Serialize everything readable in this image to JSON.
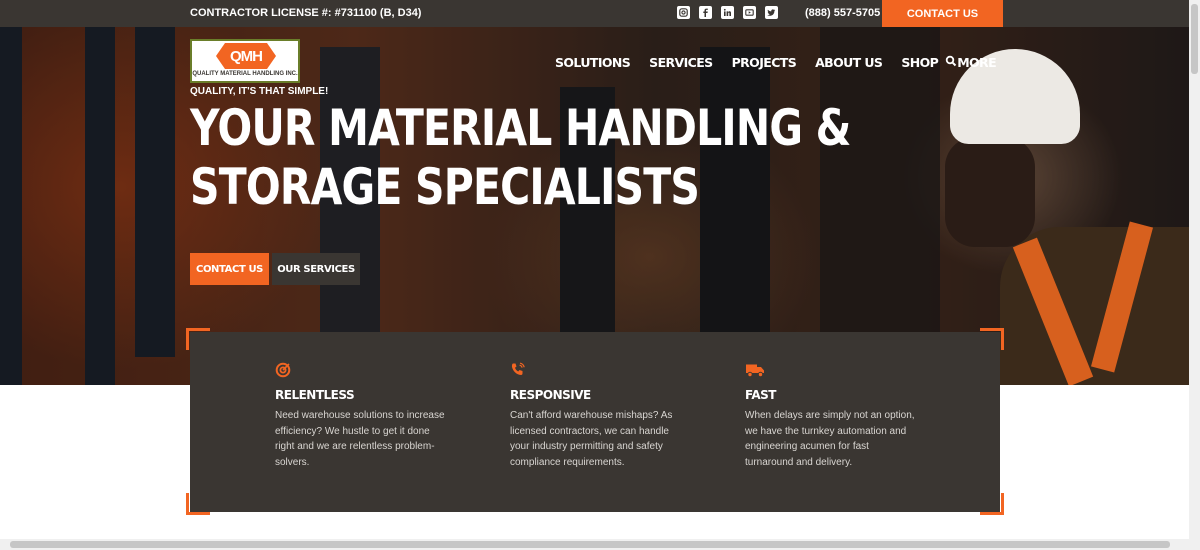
{
  "topbar": {
    "license": "CONTRACTOR LICENSE #: #731100 (B, D34)",
    "socials": [
      "instagram-icon",
      "facebook-icon",
      "linkedin-icon",
      "youtube-icon",
      "twitter-icon"
    ],
    "phone": "(888) 557-5705",
    "contact_label": "CONTACT US"
  },
  "logo": {
    "mark": "QMH",
    "name": "QUALITY MATERIAL HANDLING INC.",
    "tagline": "QUALITY, IT'S THAT SIMPLE!"
  },
  "nav": {
    "items": [
      "SOLUTIONS",
      "SERVICES",
      "PROJECTS",
      "ABOUT US",
      "SHOP",
      "MORE"
    ],
    "search_icon": "search-icon"
  },
  "hero": {
    "headline_line1": "YOUR MATERIAL HANDLING &",
    "headline_line2": "STORAGE SPECIALISTS",
    "contact_button": "CONTACT US",
    "services_button": "OUR SERVICES"
  },
  "features": [
    {
      "icon": "target-icon",
      "title": "RELENTLESS",
      "text": "Need warehouse solutions to increase efficiency? We hustle to get it done right and we are relentless problem-solvers."
    },
    {
      "icon": "phone-icon",
      "title": "RESPONSIVE",
      "text": "Can't afford warehouse mishaps? As licensed contractors, we can handle your industry permitting and safety compliance requirements."
    },
    {
      "icon": "truck-icon",
      "title": "FAST",
      "text": "When delays are simply not an option, we have the turnkey automation and engineering acumen for fast turnaround and delivery."
    }
  ],
  "colors": {
    "accent": "#f26522",
    "dark": "#3a3632"
  }
}
